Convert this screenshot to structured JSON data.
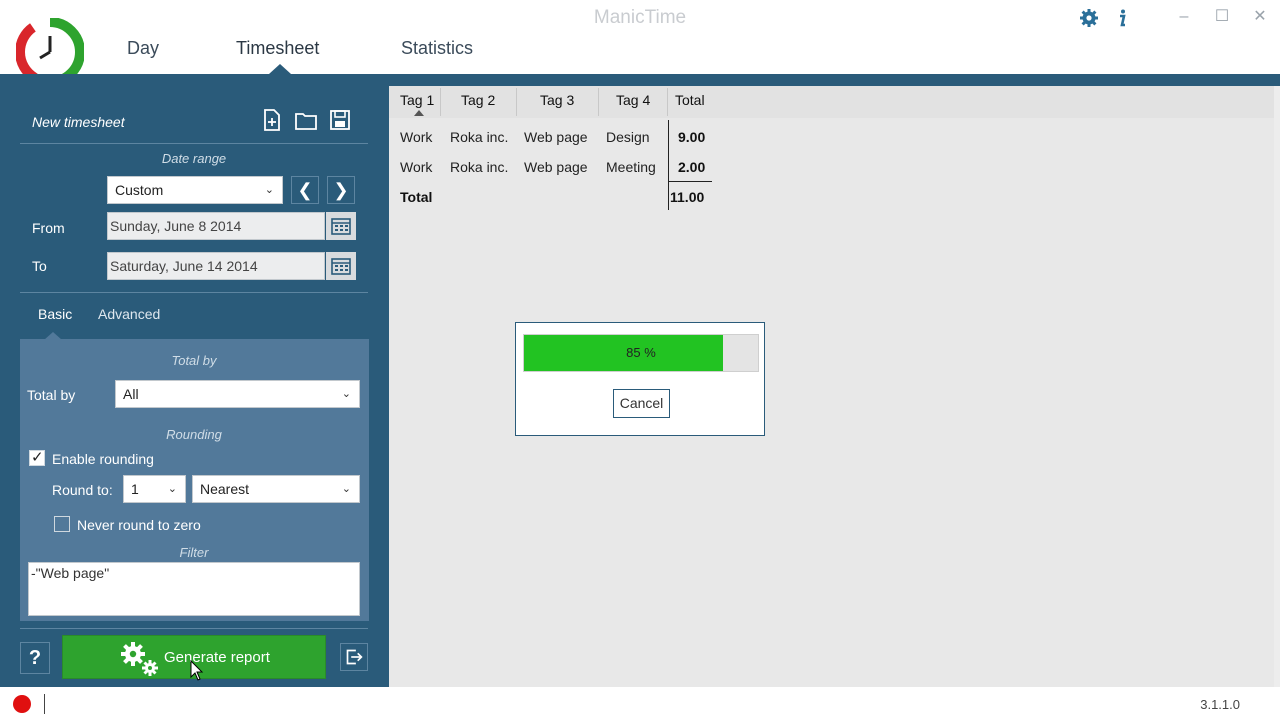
{
  "window": {
    "title": "ManicTime",
    "controls": {
      "minimize": "–",
      "maximize": "☐",
      "close": "✕"
    }
  },
  "nav": {
    "tabs": [
      {
        "label": "Day"
      },
      {
        "label": "Timesheet"
      },
      {
        "label": "Statistics"
      }
    ],
    "active": "Timesheet"
  },
  "icons": {
    "settings": "gear-icon",
    "info": "info-icon",
    "new": "new-document-icon",
    "open": "folder-icon",
    "save": "save-icon",
    "calendar": "calendar-icon",
    "help": "help-icon",
    "export": "export-icon"
  },
  "sidebar": {
    "title": "New timesheet",
    "date_range": {
      "section_label": "Date range",
      "selected": "Custom",
      "prev": "❮",
      "next": "❯"
    },
    "from": {
      "label": "From",
      "value": "Sunday, June 8 2014"
    },
    "to": {
      "label": "To",
      "value": "Saturday, June 14 2014"
    },
    "subtabs": [
      {
        "label": "Basic"
      },
      {
        "label": "Advanced"
      }
    ],
    "active_subtab": "Basic",
    "total_by": {
      "section_label": "Total by",
      "label": "Total by",
      "selected": "All"
    },
    "rounding": {
      "section_label": "Rounding",
      "enable_label": "Enable rounding",
      "enabled": true,
      "round_to_label": "Round to:",
      "round_to_value": "1",
      "mode": "Nearest",
      "never_zero_label": "Never round to zero",
      "never_zero": false
    },
    "filter": {
      "section_label": "Filter",
      "value": "-\"Web page\""
    },
    "help_label": "?",
    "generate_label": "Generate report"
  },
  "table": {
    "columns": [
      "Tag 1",
      "Tag 2",
      "Tag 3",
      "Tag 4",
      "Total"
    ],
    "rows": [
      [
        "Work",
        "Roka inc.",
        "Web page",
        "Design",
        "9.00"
      ],
      [
        "Work",
        "Roka inc.",
        "Web page",
        "Meeting",
        "2.00"
      ]
    ],
    "total_label": "Total",
    "total_value": "11.00"
  },
  "progress": {
    "percent": 85,
    "text": "85 %",
    "cancel_label": "Cancel"
  },
  "statusbar": {
    "version": "3.1.1.0"
  },
  "colors": {
    "accent": "#2a5b7a",
    "progress": "#22c322",
    "generate": "#2ea32e",
    "record": "#e01010"
  }
}
